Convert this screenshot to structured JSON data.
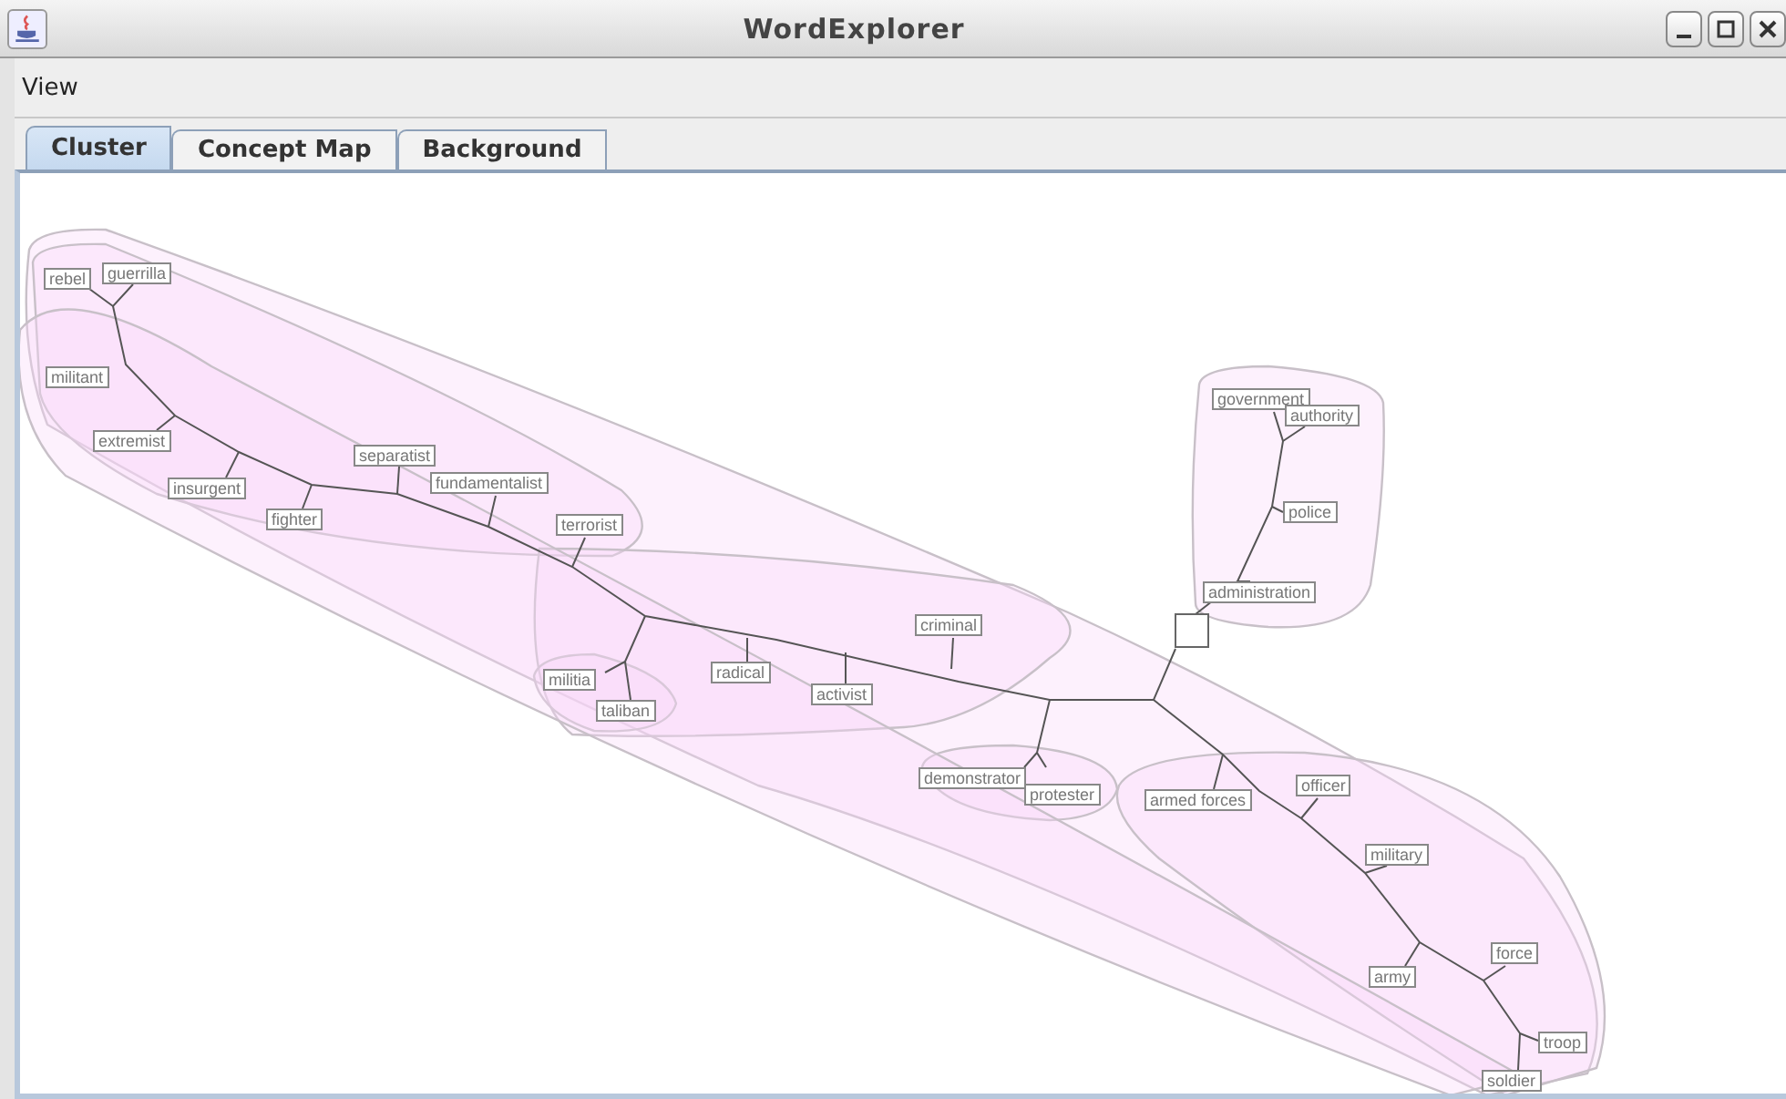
{
  "window": {
    "title": "WordExplorer"
  },
  "menu": [
    "View"
  ],
  "tabs": [
    {
      "label": "Cluster",
      "selected": true
    },
    {
      "label": "Concept Map",
      "selected": false
    },
    {
      "label": "Background",
      "selected": false
    }
  ],
  "nodes": [
    {
      "label": "rebel"
    },
    {
      "label": "guerrilla"
    },
    {
      "label": "militant"
    },
    {
      "label": "extremist"
    },
    {
      "label": "insurgent"
    },
    {
      "label": "fighter"
    },
    {
      "label": "separatist"
    },
    {
      "label": "fundamentalist"
    },
    {
      "label": "terrorist"
    },
    {
      "label": "militia"
    },
    {
      "label": "taliban"
    },
    {
      "label": "radical"
    },
    {
      "label": "activist"
    },
    {
      "label": "criminal"
    },
    {
      "label": "demonstrator"
    },
    {
      "label": "protester"
    },
    {
      "label": "armed forces"
    },
    {
      "label": "officer"
    },
    {
      "label": "military"
    },
    {
      "label": "army"
    },
    {
      "label": "force"
    },
    {
      "label": "troop"
    },
    {
      "label": "soldier"
    },
    {
      "label": "government"
    },
    {
      "label": "authority"
    },
    {
      "label": "police"
    },
    {
      "label": "administration"
    }
  ]
}
